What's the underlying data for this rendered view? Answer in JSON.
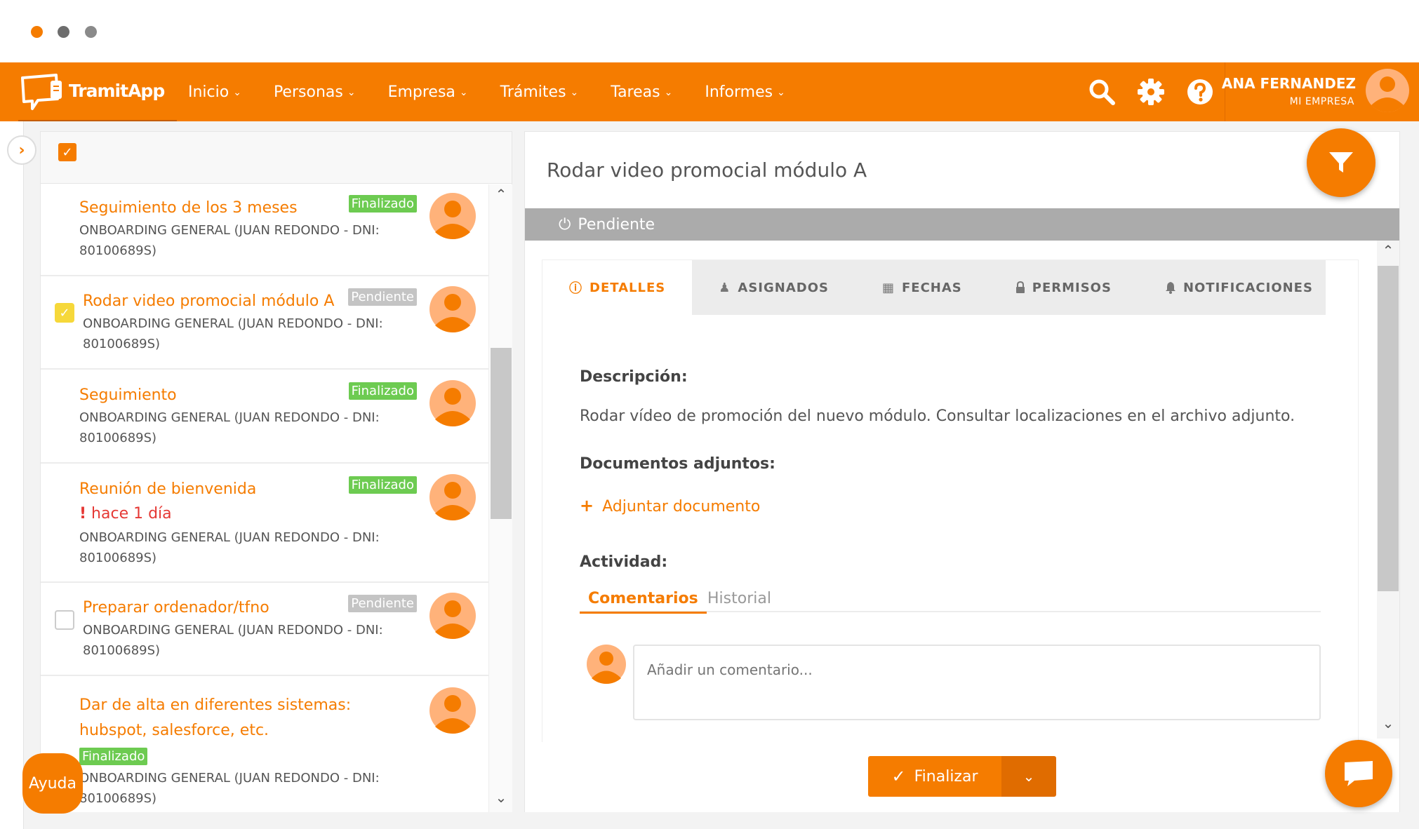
{
  "nav": {
    "logo_text": "TramitApp",
    "menu": [
      {
        "label": "Inicio"
      },
      {
        "label": "Personas"
      },
      {
        "label": "Empresa"
      },
      {
        "label": "Trámites"
      },
      {
        "label": "Tareas"
      },
      {
        "label": "Informes"
      }
    ],
    "user_name": "ANA FERNANDEZ",
    "user_company": "MI EMPRESA"
  },
  "tasks": [
    {
      "title": "Seguimiento de los 3 meses",
      "badge": "Finalizado",
      "meta": "ONBOARDING GENERAL (JUAN REDONDO - DNI: 80100689S)"
    },
    {
      "title": "Rodar video promocial módulo A",
      "badge": "Pendiente",
      "meta": "ONBOARDING GENERAL (JUAN REDONDO - DNI: 80100689S)"
    },
    {
      "title": "Seguimiento",
      "badge": "Finalizado",
      "meta": "ONBOARDING GENERAL (JUAN REDONDO - DNI: 80100689S)"
    },
    {
      "title": "Reunión de bienvenida",
      "badge": "Finalizado",
      "overdue": "hace 1 día",
      "meta": "ONBOARDING GENERAL (JUAN REDONDO - DNI: 80100689S)"
    },
    {
      "title": "Preparar ordenador/tfno",
      "badge": "Pendiente",
      "meta": "ONBOARDING GENERAL (JUAN REDONDO - DNI: 80100689S)"
    },
    {
      "title": "Dar de alta en diferentes sistemas: hubspot, salesforce, etc.",
      "badge": "Finalizado",
      "meta": "ONBOARDING GENERAL (JUAN REDONDO - DNI: 80100689S)"
    }
  ],
  "help_label": "Ayuda",
  "detail": {
    "title": "Rodar video promocial módulo A",
    "status": "Pendiente",
    "tabs": [
      {
        "label": "DETALLES"
      },
      {
        "label": "ASIGNADOS"
      },
      {
        "label": "FECHAS"
      },
      {
        "label": "PERMISOS"
      },
      {
        "label": "NOTIFICACIONES"
      }
    ],
    "description_label": "Descripción:",
    "description_text": "Rodar vídeo de promoción del nuevo módulo. Consultar localizaciones en el archivo adjunto.",
    "attachments_label": "Documentos adjuntos:",
    "attach_link": "Adjuntar documento",
    "activity_label": "Actividad:",
    "activity_tabs": [
      "Comentarios",
      "Historial"
    ],
    "comment_placeholder": "Añadir un comentario...",
    "finalize_label": "Finalizar"
  },
  "colors": {
    "accent": "#f57c00",
    "finalizado": "#6dcb51",
    "pendiente": "#c4c4c4",
    "overdue": "#e53935"
  }
}
